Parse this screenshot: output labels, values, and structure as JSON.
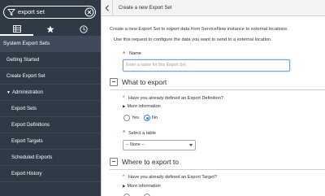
{
  "nav": {
    "filter": {
      "value": "export set"
    },
    "header": "System Export Sets",
    "items": [
      {
        "label": "Getting Started",
        "level": 1
      },
      {
        "label": "Create Export Set",
        "level": 1
      },
      {
        "label": "Administration",
        "level": 1,
        "expanded": true
      },
      {
        "label": "Export Sets",
        "level": 2
      },
      {
        "label": "Export Definitions",
        "level": 2
      },
      {
        "label": "Export Targets",
        "level": 2
      },
      {
        "label": "Scheduled Exports",
        "level": 2
      },
      {
        "label": "Export History",
        "level": 2
      }
    ],
    "tab_icons": [
      "menu-icon",
      "star-icon",
      "clock-icon"
    ]
  },
  "main": {
    "title": "Create a new Export Set",
    "intro_1": "Create a new Export Set to export data from ServiceNow instance to external locations.",
    "intro_2": "Use this request to configure the data you want to send to a external location.",
    "name_field": {
      "label": "Name",
      "placeholder": "Enter a name for this Export Set"
    },
    "section_1": {
      "title": "What to export",
      "question": "Have you already defined an Export Definition?",
      "more_info": "More information",
      "yes_label": "Yes",
      "no_label": "No",
      "selected": "No"
    },
    "table_field": {
      "label": "Select a table",
      "value": "-- None --"
    },
    "section_2": {
      "title": "Where to export to",
      "question": "Have you already defined an Export Target?",
      "more_info": "More information"
    }
  },
  "colors": {
    "nav_bg": "#303a46",
    "nav_header_bg": "#3f4b5a",
    "required": "#c83c36",
    "accent": "#3c7dd9"
  }
}
